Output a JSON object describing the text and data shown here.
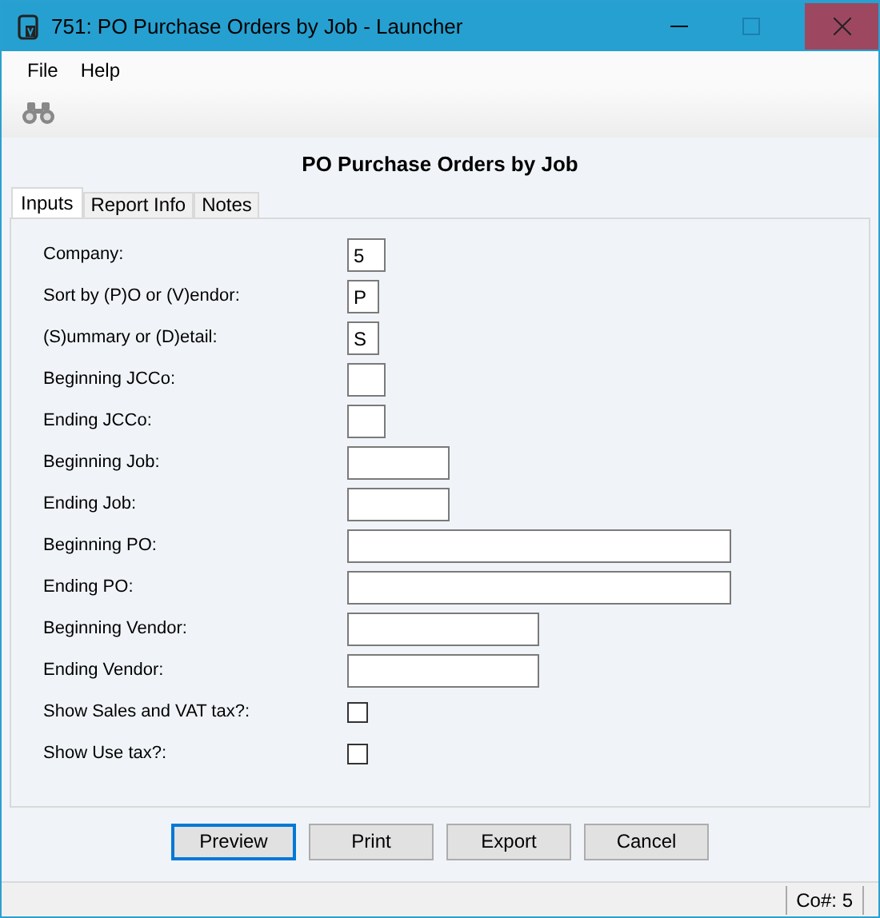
{
  "window": {
    "title": "751: PO Purchase Orders by Job - Launcher"
  },
  "menu": [
    "File",
    "Help"
  ],
  "report_title": "PO Purchase Orders by Job",
  "tabs": [
    {
      "label": "Inputs",
      "selected": true
    },
    {
      "label": "Report Info",
      "selected": false
    },
    {
      "label": "Notes",
      "selected": false
    }
  ],
  "fields": [
    {
      "kind": "text",
      "label": "Company:",
      "value": "5"
    },
    {
      "kind": "text",
      "label": "Sort by (P)O or (V)endor:",
      "value": "P"
    },
    {
      "kind": "text",
      "label": "(S)ummary or (D)etail:",
      "value": "S"
    },
    {
      "kind": "text",
      "label": "Beginning JCCo:"
    },
    {
      "kind": "text",
      "label": "Ending JCCo:"
    },
    {
      "kind": "text",
      "label": "Beginning Job:"
    },
    {
      "kind": "text",
      "label": "Ending Job:"
    },
    {
      "kind": "text",
      "label": "Beginning PO:"
    },
    {
      "kind": "text",
      "label": "Ending PO:"
    },
    {
      "kind": "text",
      "label": "Beginning Vendor:"
    },
    {
      "kind": "text",
      "label": "Ending Vendor:"
    },
    {
      "kind": "checkbox",
      "label": "Show Sales and VAT tax?:",
      "checked": false
    },
    {
      "kind": "checkbox",
      "label": "Show Use tax?:",
      "checked": false
    }
  ],
  "buttons": [
    {
      "label": "Preview",
      "focused": true
    },
    {
      "label": "Print",
      "focused": false
    },
    {
      "label": "Export",
      "focused": false
    },
    {
      "label": "Cancel",
      "focused": false
    }
  ],
  "status_bar": {
    "company": "Co#: 5"
  }
}
